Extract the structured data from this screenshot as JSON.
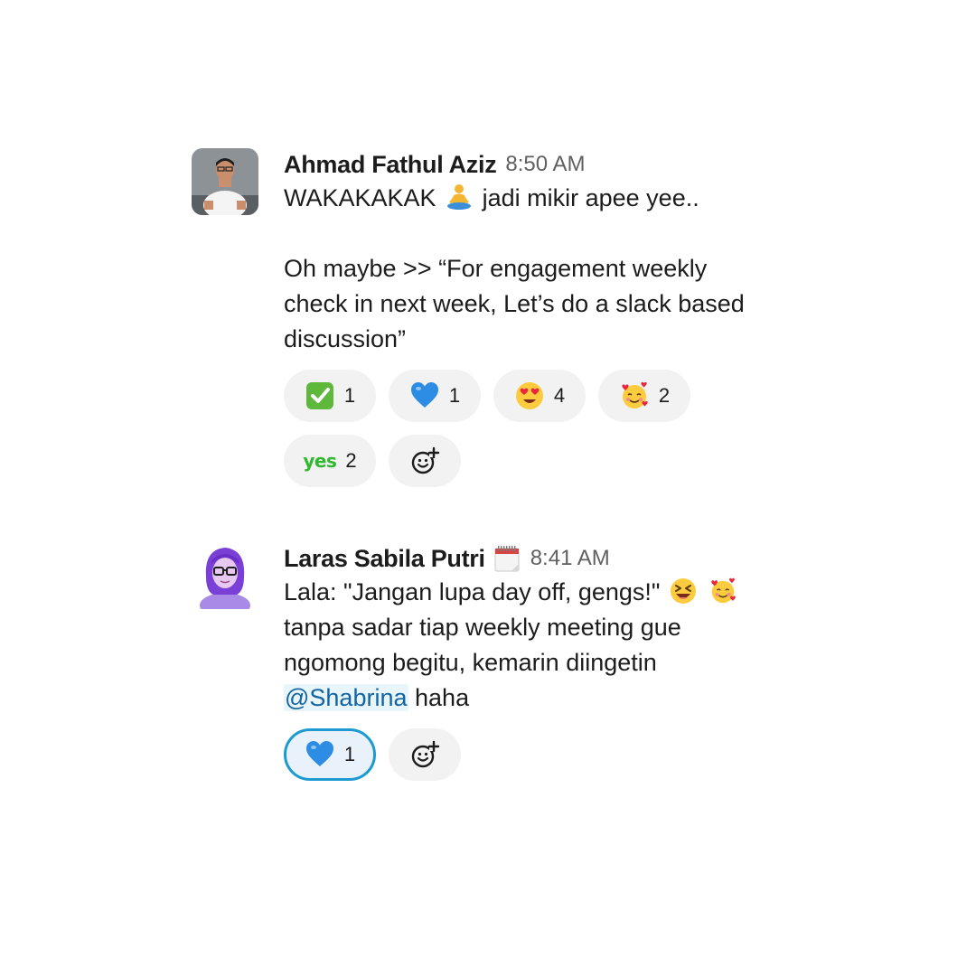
{
  "messages": [
    {
      "author": "Ahmad Fathul Aziz",
      "time": "8:50 AM",
      "avatar_icon": "person-avatar",
      "lines": {
        "l1_before": "WAKAKAKAK",
        "l1_emoji": "person-lotus-position-emoji",
        "l1_after": "jadi mikir apee yee..",
        "l2": "Oh maybe >> “For engagement weekly",
        "l3": "check in next week, Let’s do a slack based",
        "l4": "discussion”"
      },
      "reactions": [
        {
          "emoji": "white-check-mark-emoji",
          "count": "1"
        },
        {
          "emoji": "blue-heart-emoji",
          "count": "1"
        },
        {
          "emoji": "heart-eyes-emoji",
          "count": "4"
        },
        {
          "emoji": "smiling-face-with-hearts-emoji",
          "count": "2"
        },
        {
          "emoji": "yes-emoji",
          "emoji_text": "yes",
          "count": "2"
        }
      ]
    },
    {
      "author": "Laras Sabila Putri",
      "status_emoji": "calendar-emoji",
      "time": "8:41 AM",
      "avatar_icon": "person-avatar-purple",
      "lines": {
        "l1": "Lala: \"Jangan lupa day off, gengs!\"",
        "l1_emojis": [
          "laughing-emoji",
          "smiling-face-with-hearts-emoji"
        ],
        "l2": "tanpa sadar tiap weekly meeting gue",
        "l3": "ngomong begitu, kemarin diingetin",
        "mention": "@Shabrina",
        "l4_after": "haha"
      },
      "reactions": [
        {
          "emoji": "blue-heart-emoji",
          "count": "1",
          "active": true
        }
      ]
    }
  ],
  "colors": {
    "mention_text": "#1264a3",
    "mention_bg": "#e8f5fa",
    "reaction_bg": "#f2f2f2",
    "reaction_active_border": "#1d9bd1",
    "timestamp": "#616061"
  }
}
